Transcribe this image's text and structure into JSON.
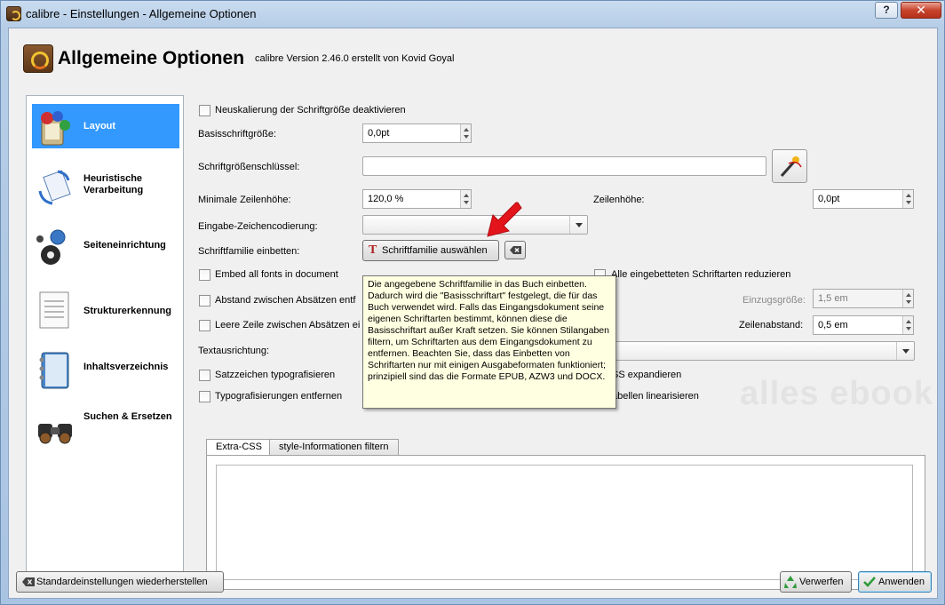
{
  "window": {
    "title": "calibre - Einstellungen - Allgemeine Optionen",
    "help": "?",
    "close": "✕"
  },
  "header": {
    "title": "Allgemeine Optionen",
    "subtitle": "calibre Version 2.46.0 erstellt von Kovid Goyal"
  },
  "sidebar": {
    "items": [
      {
        "label": "Layout",
        "icon": "layout-icon",
        "active": true
      },
      {
        "label": "Heuristische Verarbeitung",
        "icon": "heuristics-icon"
      },
      {
        "label": "Seiteneinrichtung",
        "icon": "page-setup-icon"
      },
      {
        "label": "Strukturerkennung",
        "icon": "structure-icon"
      },
      {
        "label": "Inhaltsverzeichnis",
        "icon": "toc-icon"
      },
      {
        "label": "Suchen & Ersetzen",
        "icon": "search-replace-icon"
      }
    ]
  },
  "form": {
    "disable_rescale": "Neuskalierung der Schriftgröße deaktivieren",
    "base_font_size_label": "Basisschriftgröße:",
    "base_font_size_value": "0,0pt",
    "font_key_label": "Schriftgrößenschlüssel:",
    "font_key_value": "",
    "min_line_height_label": "Minimale Zeilenhöhe:",
    "min_line_height_value": "120,0 %",
    "line_height_label": "Zeilenhöhe:",
    "line_height_value": "0,0pt",
    "input_encoding_label": "Eingabe-Zeichencodierung:",
    "input_encoding_value": "",
    "embed_font_label": "Schriftfamilie einbetten:",
    "embed_font_button": "Schriftfamilie auswählen",
    "embed_all_fonts": "Embed all fonts in document",
    "subset_fonts": "Alle eingebetteten Schriftarten reduzieren",
    "para_spacing": "Abstand zwischen Absätzen entf",
    "indent_label": "Einzugsgröße:",
    "indent_value": "1,5 em",
    "blank_line": "Leere Zeile zwischen Absätzen ei",
    "line_spacing_label": "Zeilenabstand:",
    "line_spacing_value": "0,5 em",
    "text_align_label": "Textausrichtung:",
    "smarten_punct": "Satzzeichen typografisieren",
    "expand_css": "SS expandieren",
    "unsmarten": "Typografisierungen entfernen",
    "linearize_tables": "abellen linearisieren"
  },
  "tabs": [
    {
      "label": "Extra-CSS",
      "active": true
    },
    {
      "label": "style-Informationen filtern"
    }
  ],
  "tooltip": "Die angegebene Schriftfamilie in das Buch einbetten. Dadurch wird die \"Basisschriftart\" festgelegt, die für das Buch verwendet wird. Falls das Eingangsdokument seine eigenen Schriftarten bestimmt, können diese die Basisschriftart außer Kraft setzen. Sie können Stilangaben filtern, um Schriftarten aus dem Eingangsdokument zu entfernen. Beachten Sie, dass das Einbetten von Schriftarten nur mit einigen Ausgabeformaten funktioniert; prinzipiell sind das die Formate EPUB, AZW3 und DOCX.",
  "watermark": "alles ebook",
  "footer": {
    "restore_defaults": "Standardeinstellungen wiederherstellen",
    "discard": "Verwerfen",
    "apply": "Anwenden"
  },
  "colors": {
    "selection": "#3399ff",
    "tooltip_bg": "#ffffe1",
    "arrow": "#e3141b"
  }
}
